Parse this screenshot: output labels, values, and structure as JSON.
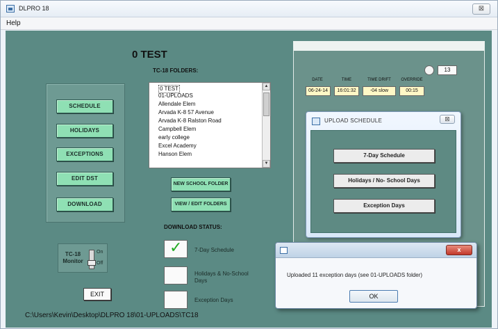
{
  "window": {
    "title": "DLPRO 18",
    "close_glyph": "⊠"
  },
  "menu": {
    "help": "Help"
  },
  "main": {
    "test_title": "0 TEST",
    "left_buttons": [
      "SCHEDULE",
      "HOLIDAYS",
      "EXCEPTIONS",
      "EDIT DST",
      "DOWNLOAD"
    ],
    "tc_monitor": {
      "label": "TC-18 Monitor",
      "on": "On",
      "off": "Off"
    },
    "exit_label": "EXIT",
    "path": "C:\\Users\\Kevin\\Desktop\\DLPRO 18\\01-UPLOADS\\TC18"
  },
  "folders": {
    "label": "TC-18 FOLDERS:",
    "items": [
      "0 TEST",
      "01-UPLOADS",
      "Allendale Elem",
      "Arvada K-8 57 Avenue",
      "Arvada K-8 Ralston Road",
      "Campbell Elem",
      "early college",
      "Excel Academy",
      "Hanson Elem"
    ],
    "new_folder_label": "NEW SCHOOL FOLDER",
    "view_edit_label": "VIEW / EDIT FOLDERS"
  },
  "download_status": {
    "label": "DOWNLOAD STATUS:",
    "items": [
      {
        "text": "7-Day Schedule",
        "checked": true
      },
      {
        "text": "Holidays & No-School Days",
        "checked": false
      },
      {
        "text": "Exception Days",
        "checked": false
      }
    ]
  },
  "clock_panel": {
    "temp": "13",
    "labels": {
      "date": "DATE",
      "time": "TIME",
      "drift": "TIME DRIFT",
      "override": "OVERRIDE"
    },
    "values": {
      "date": "06-24-14",
      "time": "16:01:32",
      "drift": "-04 slow",
      "override": "00:15"
    }
  },
  "upload_dialog": {
    "title": "UPLOAD SCHEDULE",
    "buttons": [
      "7-Day Schedule",
      "Holidays / No- School Days",
      "Exception Days"
    ]
  },
  "message_dialog": {
    "close_glyph": "x",
    "text": "Uploaded 11 exception days (see 01-UPLOADS folder)",
    "ok_label": "OK"
  }
}
